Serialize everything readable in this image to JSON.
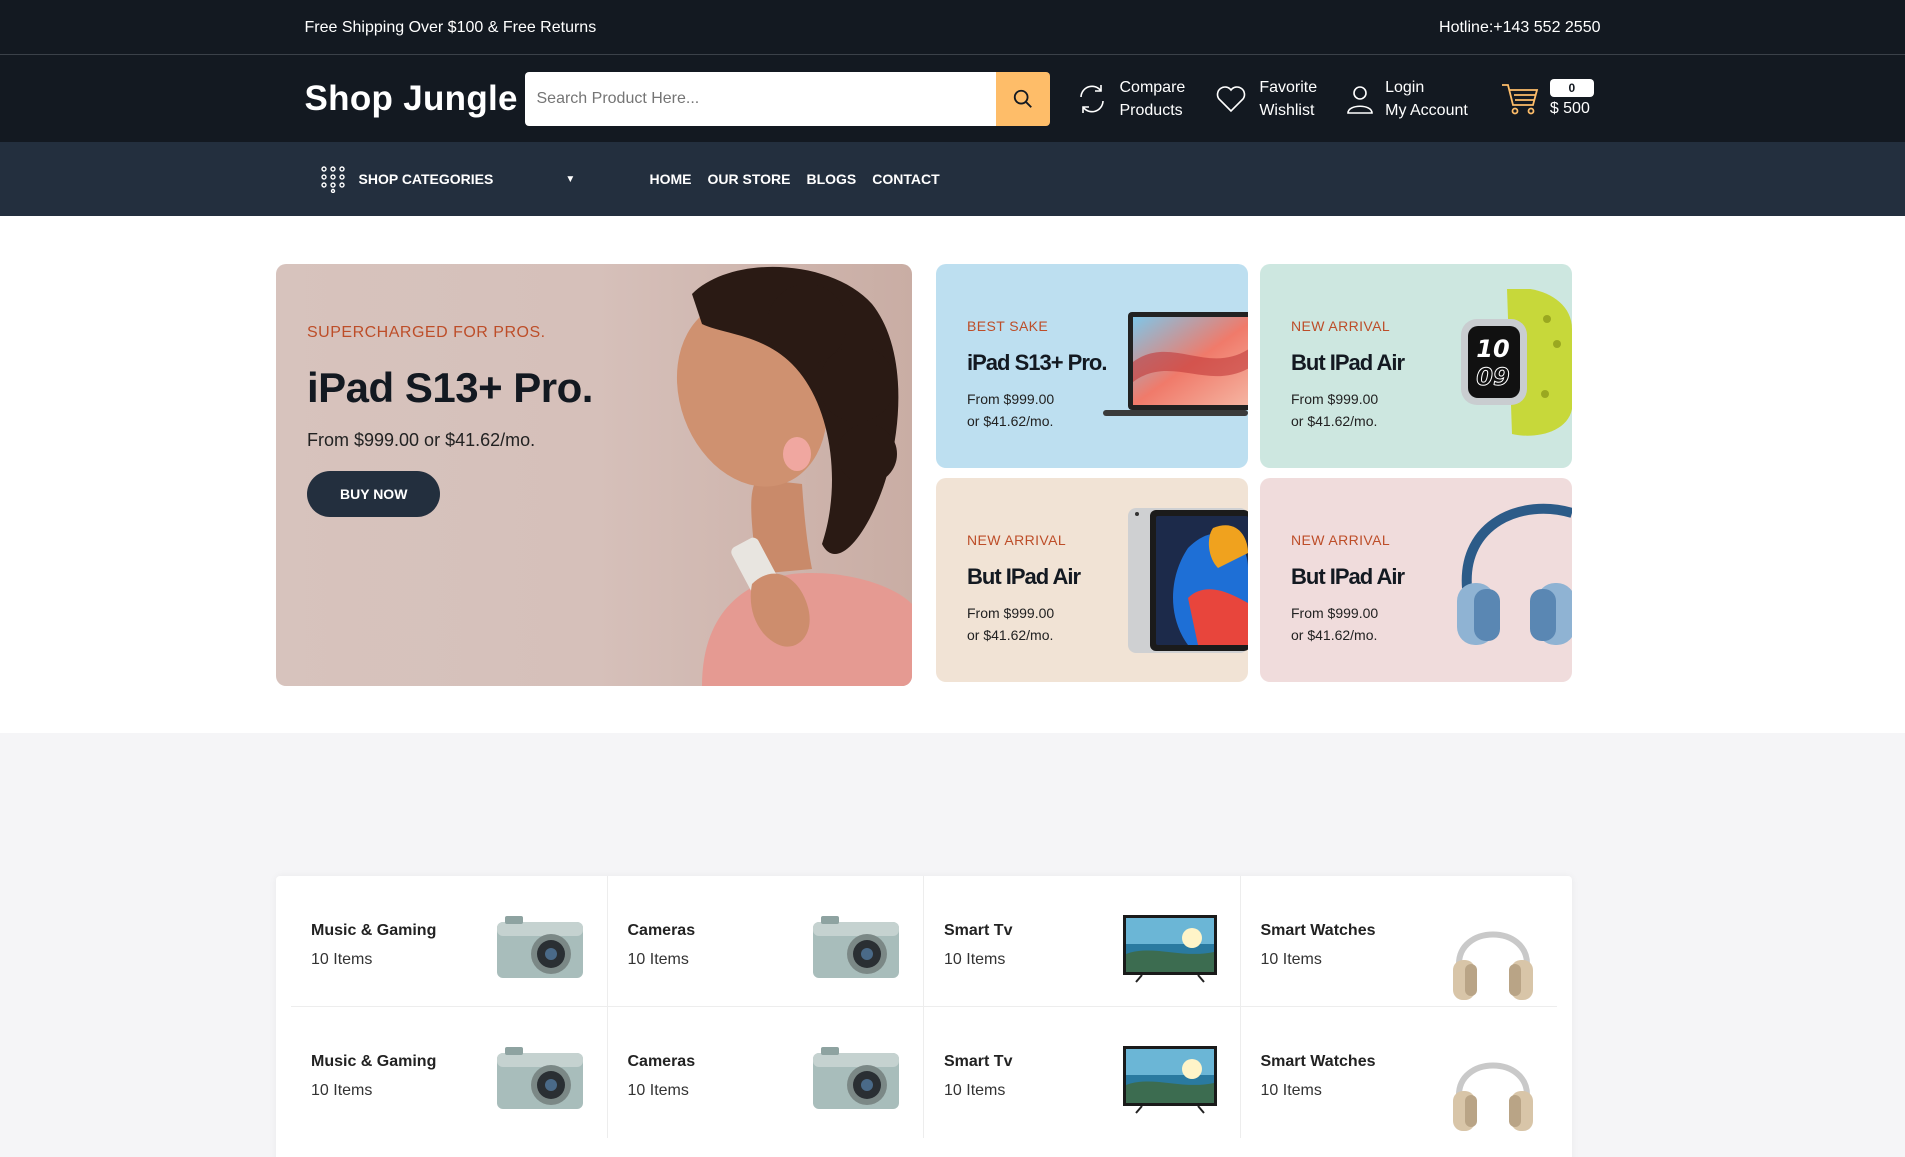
{
  "topbar": {
    "shipping": "Free Shipping Over $100 & Free Returns",
    "hotline": "Hotline:+143 552 2550"
  },
  "header": {
    "logo": "Shop Jungle",
    "search_placeholder": "Search Product Here...",
    "compare": [
      "Compare",
      "Products"
    ],
    "wishlist": [
      "Favorite",
      "Wishlist"
    ],
    "account": [
      "Login",
      "My Account"
    ],
    "cart_count": "0",
    "cart_total": "$ 500"
  },
  "nav": {
    "categories": "SHOP CATEGORIES",
    "menu": [
      "HOME",
      "OUR STORE",
      "BLOGS",
      "CONTACT"
    ]
  },
  "hero": {
    "main": {
      "kicker": "SUPERCHARGED FOR PROS.",
      "title": "iPad S13+ Pro.",
      "price": "From $999.00 or $41.62/mo.",
      "cta": "BUY NOW"
    },
    "cards": [
      {
        "kicker": "BEST SAKE",
        "title": "iPad S13+ Pro.",
        "line1": "From $999.00",
        "line2": "or $41.62/mo.",
        "image": "laptop-image",
        "bg": "#bddff0"
      },
      {
        "kicker": "NEW ARRIVAL",
        "title": "But IPad Air",
        "line1": "From $999.00",
        "line2": "or $41.62/mo.",
        "image": "smartwatch-image",
        "bg": "#cde7e0"
      },
      {
        "kicker": "NEW ARRIVAL",
        "title": "But IPad Air",
        "line1": "From $999.00",
        "line2": "or $41.62/mo.",
        "image": "tablet-image",
        "bg": "#f1e3d5"
      },
      {
        "kicker": "NEW ARRIVAL",
        "title": "But IPad Air",
        "line1": "From $999.00",
        "line2": "or $41.62/mo.",
        "image": "headphones-image",
        "bg": "#f0dcdc"
      }
    ]
  },
  "categories": [
    {
      "name": "Music & Gaming",
      "count": "10 Items",
      "icon": "camera"
    },
    {
      "name": "Cameras",
      "count": "10 Items",
      "icon": "camera"
    },
    {
      "name": "Smart Tv",
      "count": "10 Items",
      "icon": "tv"
    },
    {
      "name": "Smart Watches",
      "count": "10 Items",
      "icon": "headphones"
    },
    {
      "name": "Music & Gaming",
      "count": "10 Items",
      "icon": "camera"
    },
    {
      "name": "Cameras",
      "count": "10 Items",
      "icon": "camera"
    },
    {
      "name": "Smart Tv",
      "count": "10 Items",
      "icon": "tv"
    },
    {
      "name": "Smart Watches",
      "count": "10 Items",
      "icon": "headphones"
    }
  ],
  "colors": {
    "dark": "#131921",
    "nav": "#232f3e",
    "accent": "#febd69",
    "kicker": "#bd4d28"
  }
}
